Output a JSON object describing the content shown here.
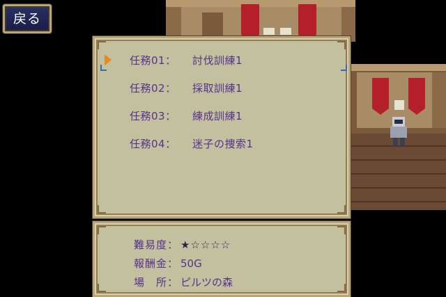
{
  "back_button": {
    "label": "戻る"
  },
  "quests": [
    {
      "code": "任務01：",
      "name": "討伐訓練1"
    },
    {
      "code": "任務02：",
      "name": "採取訓練1"
    },
    {
      "code": "任務03：",
      "name": "練成訓練1"
    },
    {
      "code": "任務04：",
      "name": "迷子の捜索1"
    }
  ],
  "selected_index": 0,
  "details": {
    "difficulty_label": "難易度：",
    "difficulty_stars": "★☆☆☆☆",
    "difficulty_rating": 1,
    "difficulty_max": 5,
    "reward_label": "報酬金：",
    "reward_value": "50G",
    "location_label": "場　所：",
    "location_value": "ピルツの森"
  },
  "colors": {
    "window_bg": "#c3c0a0",
    "window_border": "#b9a57a",
    "text": "#58328a",
    "cursor": "#e88a20"
  }
}
